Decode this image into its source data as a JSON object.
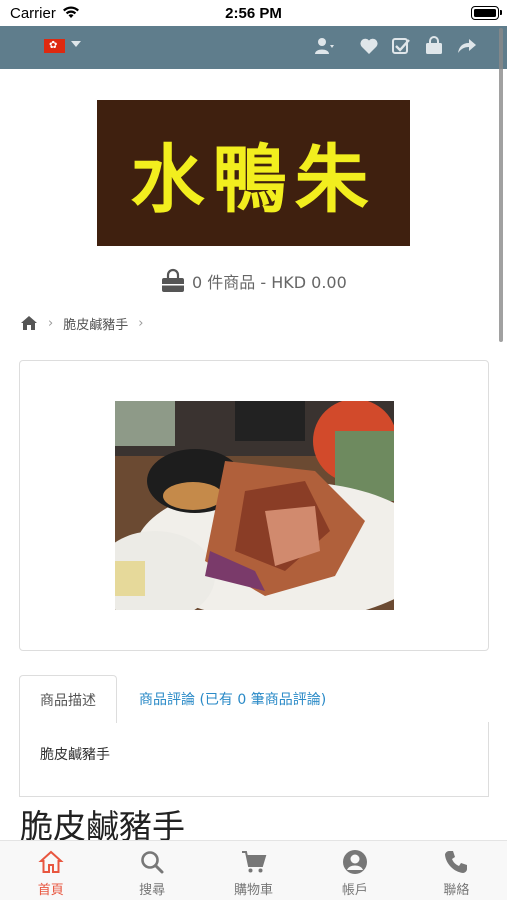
{
  "status_bar": {
    "carrier": "Carrier",
    "time": "2:56 PM"
  },
  "top_bar": {
    "flag": "hong-kong-flag-icon",
    "icons": [
      "user-icon",
      "heart-icon",
      "checklist-icon",
      "shopping-bag-icon",
      "share-icon"
    ]
  },
  "logo": {
    "text": "水鴨朱"
  },
  "cart_summary": {
    "text": "0 件商品 - HKD 0.00"
  },
  "breadcrumb": {
    "item": "脆皮鹹豬手"
  },
  "tabs": {
    "description": "商品描述",
    "reviews": "商品評論 (已有 0 筆商品評論)"
  },
  "description_text": "脆皮鹹豬手",
  "product_title": "脆皮鹹豬手",
  "bottom_nav": {
    "home": "首頁",
    "search": "搜尋",
    "cart": "購物車",
    "account": "帳戶",
    "contact": "聯絡"
  },
  "colors": {
    "topbar": "#5f7d8c",
    "accent": "#e8563f",
    "link": "#2a8ac7",
    "logo_bg": "#3f200f",
    "logo_text": "#f2ee1e"
  }
}
